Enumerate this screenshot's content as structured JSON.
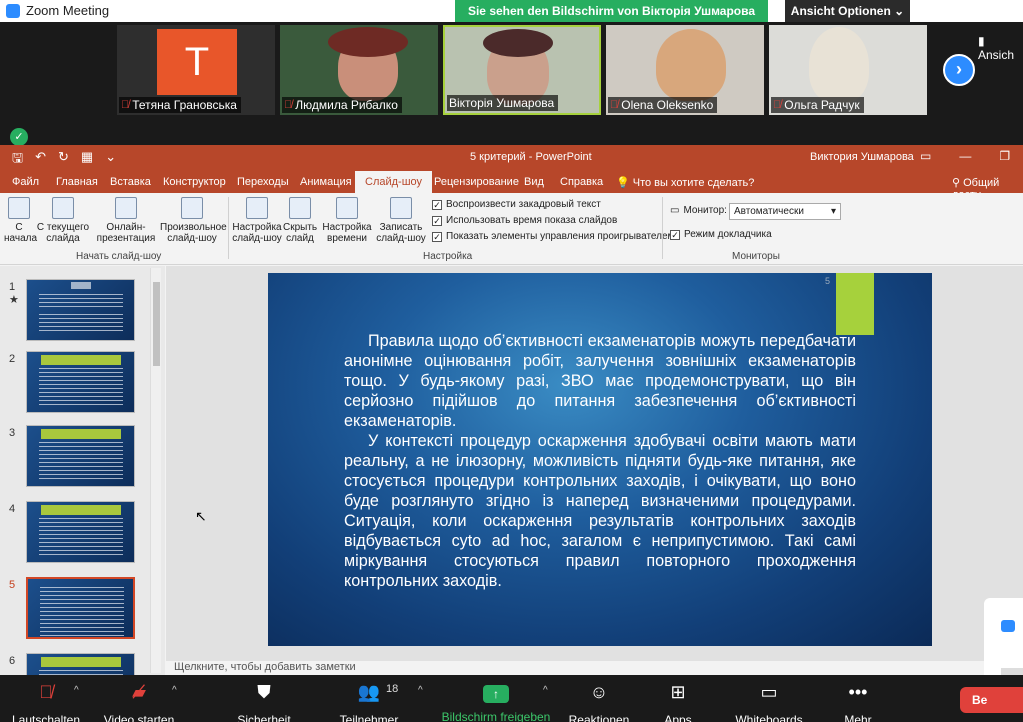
{
  "zoom": {
    "window_title": "Zoom Meeting",
    "share_banner": "Sie sehen den Bildschirm von Вікторія Ушмарова",
    "view_options": "Ansicht Optionen",
    "view_options_small": "Ansich"
  },
  "participants": [
    {
      "name": "Тетяна Грановська",
      "initial": "T",
      "muted": true
    },
    {
      "name": "Людмила Рибалко",
      "muted": true
    },
    {
      "name": "Вікторія Ушмарова",
      "muted": false
    },
    {
      "name": "Olena Oleksenko",
      "muted": true
    },
    {
      "name": "Ольга Радчук",
      "muted": true
    }
  ],
  "powerpoint": {
    "doc_title": "5 критерий  -  PowerPoint",
    "user_name": "Виктория Ушмарова",
    "tabs": [
      "Файл",
      "Главная",
      "Вставка",
      "Конструктор",
      "Переходы",
      "Анимация",
      "Слайд-шоу",
      "Рецензирование",
      "Вид",
      "Справка",
      "Что вы хотите сделать?",
      "Общий досту"
    ],
    "active_tab": "Слайд-шоу",
    "ribbon": {
      "btn_from_start": "С начала",
      "btn_from_current": "С текущего слайда",
      "btn_online": "Онлайн-презентация",
      "btn_custom": "Произвольное слайд-шоу",
      "group_start": "Начать слайд-шоу",
      "btn_setup": "Настройка слайд-шоу",
      "btn_hide": "Скрыть слайд",
      "btn_timing": "Настройка времени",
      "btn_record": "Записать слайд-шоу",
      "chk_narration": "Воспроизвести закадровый текст",
      "chk_timings": "Использовать время показа слайдов",
      "chk_controls": "Показать элементы управления проигрывателем",
      "group_setup": "Настройка",
      "monitor_label": "Монитор:",
      "monitor_value": "Автоматически",
      "chk_presenter": "Режим докладчика",
      "group_monitors": "Мониторы"
    },
    "thumbnails": [
      {
        "num": "1",
        "star": "★"
      },
      {
        "num": "2"
      },
      {
        "num": "3"
      },
      {
        "num": "4"
      },
      {
        "num": "5",
        "active": true
      },
      {
        "num": "6"
      }
    ],
    "slide": {
      "page_number": "5",
      "paragraph1": "Правила щодо об’єктивності екзаменаторів можуть передбачати анонімне оцінювання робіт, залучення зовнішніх екзаменаторів тощо. У будь-якому разі, ЗВО має продемонструвати, що він серйозно підійшов до питання забезпечення об’єктивності екзаменаторів.",
      "paragraph2": "У контексті процедур оскарження здобувачі освіти мають мати реальну, а не ілюзорну, можливість підняти будь-яке питання, яке стосується процедури контрольних заходів, і очікувати, що воно буде розглянуто згідно із наперед визначеними процедурами. Ситуація, коли оскарження результатів контрольних заходів відбувається cyto ad hoc, загалом є неприпустимою. Такі самі міркування стосуються правил повторного проходження контрольних заходів."
    },
    "notes_placeholder": "Щелкните, чтобы добавить заметки"
  },
  "toolbar": {
    "mute": "Lautschalten",
    "video": "Video starten",
    "security": "Sicherheit",
    "participants": "Teilnehmer",
    "participants_count": "18",
    "share": "Bildschirm freigeben",
    "reactions": "Reaktionen",
    "apps": "Apps",
    "whiteboards": "Whiteboards",
    "more": "Mehr",
    "end": "Be"
  },
  "colors": {
    "share_green": "#27ae60",
    "ppt_red": "#b7472a",
    "accent_lime": "#a6d13c",
    "zoom_blue": "#2d8cff"
  }
}
